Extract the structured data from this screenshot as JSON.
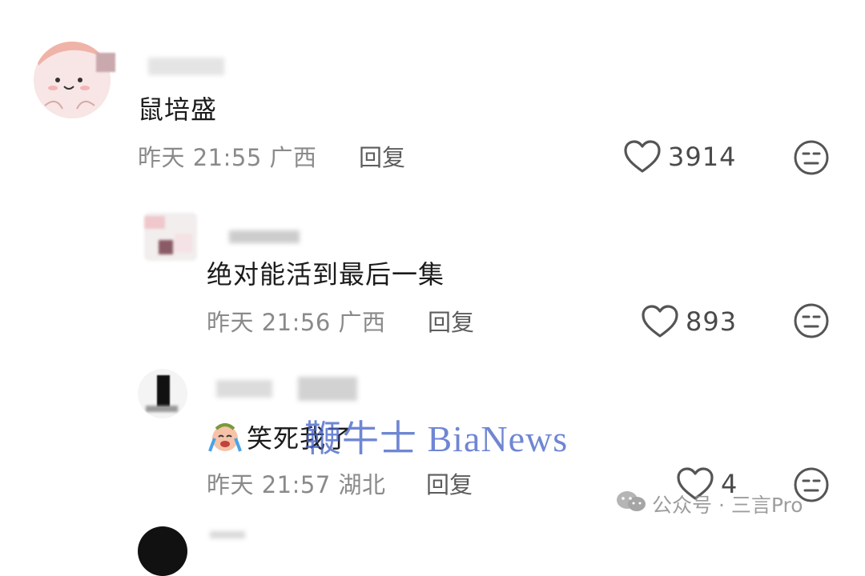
{
  "comments": [
    {
      "text": "鼠培盛",
      "date": "昨天",
      "time": "21:55",
      "region": "广西",
      "reply_label": "回复",
      "likes": "3914"
    },
    {
      "text": "绝对能活到最后一集",
      "date": "昨天",
      "time": "21:56",
      "region": "广西",
      "reply_label": "回复",
      "likes": "893"
    },
    {
      "emoji": "crying-laughing-emoji",
      "text": "笑死我了",
      "date": "昨天",
      "time": "21:57",
      "region": "湖北",
      "reply_label": "回复",
      "likes": "4"
    }
  ],
  "watermark": "鞭牛士 BiaNews",
  "credit": "公众号 · 三言Pro",
  "icons": {
    "like": "heart-outline-icon",
    "dislike": "neutral-face-icon",
    "credit": "wechat-icon"
  },
  "colors": {
    "meta": "#8a8a8a",
    "watermark": "#4664c8"
  }
}
